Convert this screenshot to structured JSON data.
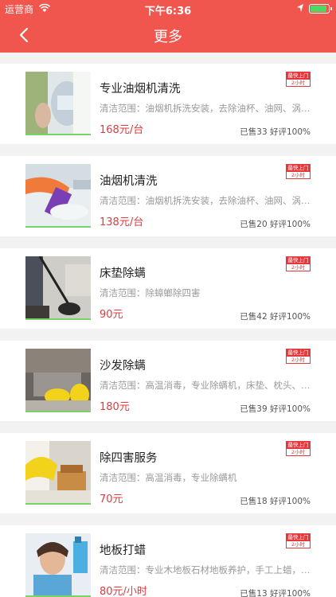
{
  "status_bar": {
    "carrier": "运营商",
    "time": "下午6:36",
    "battery_color": "#4cd964"
  },
  "nav": {
    "title": "更多",
    "back_icon": "chevron-left-icon",
    "color": "#f1564e"
  },
  "badge": {
    "line1": "最快上门",
    "line2": "2小时"
  },
  "items": [
    {
      "name": "专业油烟机清洗",
      "scope": "清洁范围：油烟机拆洗安装，去除油杯、油网、涡轮、风叶",
      "price": "168元/台",
      "sales": "已售33 好评100%"
    },
    {
      "name": "油烟机清洗",
      "scope": "清洁范围：油烟机拆洗安装，去除油杯、油网、涡轮、风叶",
      "price": "138元/台",
      "sales": "已售20 好评100%"
    },
    {
      "name": "床垫除螨",
      "scope": "清洁范围：除蟑螂除四害",
      "price": "90元",
      "sales": "已售42 好评100%"
    },
    {
      "name": "沙发除螨",
      "scope": "清洁范围：高温消毒，专业除螨机，床垫、枕头、沙发",
      "price": "180元",
      "sales": "已售39 好评100%"
    },
    {
      "name": "除四害服务",
      "scope": "清洁范围：高温消毒，专业除螨机",
      "price": "70元",
      "sales": "已售18 好评100%"
    },
    {
      "name": "地板打蜡",
      "scope": "清洁范围：专业木地板石材地板养护，手工上蜡，抛光",
      "price": "80元/小时",
      "sales": "已售13 好评100%"
    }
  ]
}
